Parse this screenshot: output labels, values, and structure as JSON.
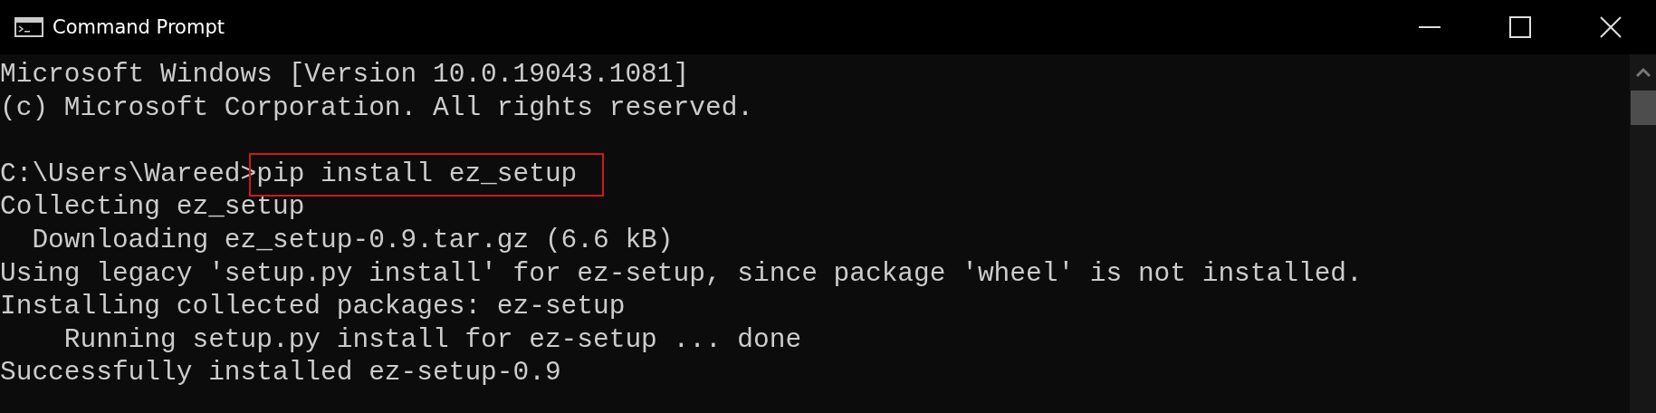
{
  "window": {
    "title": "Command Prompt"
  },
  "lines": [
    {
      "kind": "text",
      "text": "Microsoft Windows [Version 10.0.19043.1081]"
    },
    {
      "kind": "text",
      "text": "(c) Microsoft Corporation. All rights reserved."
    },
    {
      "kind": "blank"
    },
    {
      "kind": "prompt",
      "prompt": "C:\\Users\\Wareed>",
      "command": "pip install ez_setup",
      "highlighted": true
    },
    {
      "kind": "text",
      "text": "Collecting ez_setup"
    },
    {
      "kind": "text",
      "text": "  Downloading ez_setup-0.9.tar.gz (6.6 kB)"
    },
    {
      "kind": "text",
      "text": "Using legacy 'setup.py install' for ez-setup, since package 'wheel' is not installed."
    },
    {
      "kind": "text",
      "text": "Installing collected packages: ez-setup"
    },
    {
      "kind": "text",
      "text": "    Running setup.py install for ez-setup ... done"
    },
    {
      "kind": "text",
      "text": "Successfully installed ez-setup-0.9"
    }
  ]
}
